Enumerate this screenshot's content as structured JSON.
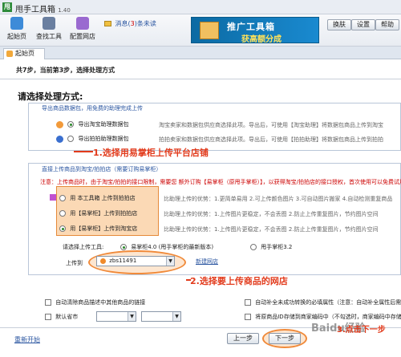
{
  "window": {
    "title": "甩手工具箱",
    "version": "1.40",
    "app_icon_glyph": "甩"
  },
  "toolbar": {
    "buttons": [
      {
        "label": "起始页",
        "color": "#3d8bd8"
      },
      {
        "label": "查找工具",
        "color": "#6a7fa0"
      },
      {
        "label": "配置网店",
        "color": "#9a6ad0"
      }
    ],
    "messages_label": "消息(",
    "messages_count": "3",
    "messages_suffix": ")条未读",
    "banner_line1": "推广工具箱",
    "banner_line2": "获高额分成",
    "right_buttons": [
      "换肤",
      "设置",
      "帮助"
    ]
  },
  "tabs": [
    {
      "label": "起始页"
    }
  ],
  "step_info": "共7步，当前第3步，选择处理方式",
  "headline": "请选择处理方式:",
  "section1": {
    "legend": "导出商品数据包，用免费的助理完成上传",
    "options": [
      {
        "label": "导出淘宝助理数据包",
        "selected": true,
        "desc": "淘宝卖家和数据包供应商选择此项。导出后，可使用【淘宝助理】将数据包商品上传到淘宝"
      },
      {
        "label": "导出拍拍助理数据包",
        "selected": false,
        "desc": "拍拍卖家和数据包供应商选择此项。导出后，可使用【拍拍助理】将数据包商品上传到拍拍"
      }
    ]
  },
  "section2": {
    "legend": "直接上传商品到淘宝/拍拍店（需要订购易掌柜）",
    "warning": "注意：上传商品时，由于淘宝/拍拍的接口限制，需要您  额外订购【易掌柜（原甩手掌柜）】，以获得淘宝/拍拍店的接口授权，首次使用可以免费试用",
    "options": [
      {
        "label": "用 本工具箱 上传到拍拍店",
        "selected": false,
        "desc": "比助理上传的优势：1.更简单易用 2.可上传颜色图片 3.可自动图片搬家 4.自动检测重复商品"
      },
      {
        "label": "用【易掌柜】上传到拍拍店",
        "selected": false,
        "desc": "比助理上传的优势：1.上传图片更稳定，不会丢图 2.防止上传重复图片，节约图片空间"
      },
      {
        "label": "用【易掌柜】上传到淘宝店",
        "selected": true,
        "desc": "比助理上传的优势：1.上传图片更稳定，不会丢图 2.防止上传重复图片，节约图片空间"
      }
    ],
    "tool_label": "请选择上传工具:",
    "tool_options": [
      {
        "label": "易掌柜4.0 (甩手掌柜的最新版本)",
        "selected": true
      },
      {
        "label": "甩手掌柜3.2",
        "selected": false
      }
    ],
    "upload_to_label": "上传到",
    "shop_value": "zbs11491",
    "new_shop_link": "新建网店"
  },
  "annotations": {
    "callout1": "1.选择用易掌柜上传平台店铺",
    "callout2": "2.选择要上传商品的网店",
    "callout3": "3.点击下一步"
  },
  "bottom_options": {
    "auto_clear": "自动清除商品描述中其他商品的链接",
    "default_province": "默认省市",
    "auto_fill": "自动补全未成功转换的必填属性（注意：自动补全属性后需要手动检查）",
    "store_id": "将原商品ID存储到商家编码中（不勾选时，商家编码中存储的是商品原货号）"
  },
  "footer": {
    "restart_link": "重新开始",
    "prev_button": "上一步",
    "next_button": "下一步",
    "watermark": "Baidu经验"
  }
}
